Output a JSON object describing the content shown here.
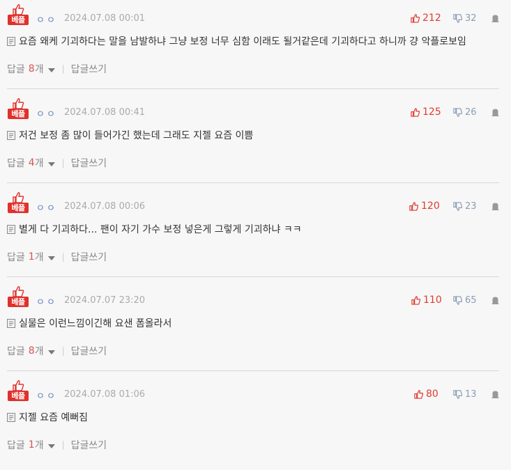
{
  "comments": [
    {
      "badge": "베플",
      "nick": "ㅇㅇ",
      "date": "2024.07.08 00:01",
      "up": "212",
      "down": "32",
      "text": "요즘 왜케 기괴하다는 말을 남발하냐 그냥 보정 너무 심함 이래도 될거같은데 기괴하다고 하니까 걍 악플로보임",
      "reply_label": "답글",
      "reply_count": "8",
      "reply_unit": "개",
      "write_reply": "답글쓰기"
    },
    {
      "badge": "베플",
      "nick": "ㅇㅇ",
      "date": "2024.07.08 00:41",
      "up": "125",
      "down": "26",
      "text": "저건 보정 좀 많이 들어가긴 했는데 그래도 지젤 요즘 이쁨",
      "reply_label": "답글",
      "reply_count": "4",
      "reply_unit": "개",
      "write_reply": "답글쓰기"
    },
    {
      "badge": "베플",
      "nick": "ㅇㅇ",
      "date": "2024.07.08 00:06",
      "up": "120",
      "down": "23",
      "text": "별게 다 기괴하다... 팬이 자기 가수 보정 넣은게 그렇게 기괴하냐 ㅋㅋ",
      "reply_label": "답글",
      "reply_count": "1",
      "reply_unit": "개",
      "write_reply": "답글쓰기"
    },
    {
      "badge": "베플",
      "nick": "ㅇㅇ",
      "date": "2024.07.07 23:20",
      "up": "110",
      "down": "65",
      "text": "실물은 이런느낌이긴해 요샌 폼올라서",
      "reply_label": "답글",
      "reply_count": "8",
      "reply_unit": "개",
      "write_reply": "답글쓰기"
    },
    {
      "badge": "베플",
      "nick": "ㅇㅇ",
      "date": "2024.07.08 01:06",
      "up": "80",
      "down": "13",
      "text": "지젤 요즘 예뻐짐",
      "reply_label": "답글",
      "reply_count": "1",
      "reply_unit": "개",
      "write_reply": "답글쓰기"
    }
  ],
  "colors": {
    "accent_red": "#e0312b",
    "nick_blue": "#5a7fb5",
    "down_blue": "#8a9db5"
  },
  "icons": {
    "best": "thumbs-up-icon",
    "up": "thumbs-up-icon",
    "down": "thumbs-down-icon",
    "report": "report-icon",
    "doc": "document-icon",
    "caret": "caret-down-icon"
  }
}
